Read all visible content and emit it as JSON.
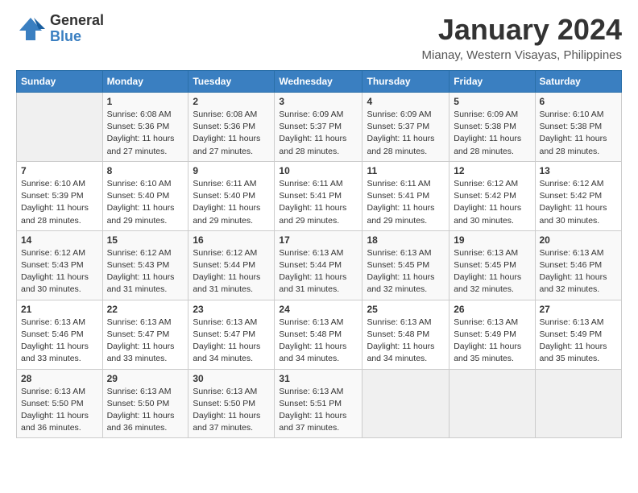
{
  "header": {
    "logo_general": "General",
    "logo_blue": "Blue",
    "month_title": "January 2024",
    "location": "Mianay, Western Visayas, Philippines"
  },
  "days_of_week": [
    "Sunday",
    "Monday",
    "Tuesday",
    "Wednesday",
    "Thursday",
    "Friday",
    "Saturday"
  ],
  "weeks": [
    [
      {
        "day": "",
        "sunrise": "",
        "sunset": "",
        "daylight": ""
      },
      {
        "day": "1",
        "sunrise": "Sunrise: 6:08 AM",
        "sunset": "Sunset: 5:36 PM",
        "daylight": "Daylight: 11 hours and 27 minutes."
      },
      {
        "day": "2",
        "sunrise": "Sunrise: 6:08 AM",
        "sunset": "Sunset: 5:36 PM",
        "daylight": "Daylight: 11 hours and 27 minutes."
      },
      {
        "day": "3",
        "sunrise": "Sunrise: 6:09 AM",
        "sunset": "Sunset: 5:37 PM",
        "daylight": "Daylight: 11 hours and 28 minutes."
      },
      {
        "day": "4",
        "sunrise": "Sunrise: 6:09 AM",
        "sunset": "Sunset: 5:37 PM",
        "daylight": "Daylight: 11 hours and 28 minutes."
      },
      {
        "day": "5",
        "sunrise": "Sunrise: 6:09 AM",
        "sunset": "Sunset: 5:38 PM",
        "daylight": "Daylight: 11 hours and 28 minutes."
      },
      {
        "day": "6",
        "sunrise": "Sunrise: 6:10 AM",
        "sunset": "Sunset: 5:38 PM",
        "daylight": "Daylight: 11 hours and 28 minutes."
      }
    ],
    [
      {
        "day": "7",
        "sunrise": "Sunrise: 6:10 AM",
        "sunset": "Sunset: 5:39 PM",
        "daylight": "Daylight: 11 hours and 28 minutes."
      },
      {
        "day": "8",
        "sunrise": "Sunrise: 6:10 AM",
        "sunset": "Sunset: 5:40 PM",
        "daylight": "Daylight: 11 hours and 29 minutes."
      },
      {
        "day": "9",
        "sunrise": "Sunrise: 6:11 AM",
        "sunset": "Sunset: 5:40 PM",
        "daylight": "Daylight: 11 hours and 29 minutes."
      },
      {
        "day": "10",
        "sunrise": "Sunrise: 6:11 AM",
        "sunset": "Sunset: 5:41 PM",
        "daylight": "Daylight: 11 hours and 29 minutes."
      },
      {
        "day": "11",
        "sunrise": "Sunrise: 6:11 AM",
        "sunset": "Sunset: 5:41 PM",
        "daylight": "Daylight: 11 hours and 29 minutes."
      },
      {
        "day": "12",
        "sunrise": "Sunrise: 6:12 AM",
        "sunset": "Sunset: 5:42 PM",
        "daylight": "Daylight: 11 hours and 30 minutes."
      },
      {
        "day": "13",
        "sunrise": "Sunrise: 6:12 AM",
        "sunset": "Sunset: 5:42 PM",
        "daylight": "Daylight: 11 hours and 30 minutes."
      }
    ],
    [
      {
        "day": "14",
        "sunrise": "Sunrise: 6:12 AM",
        "sunset": "Sunset: 5:43 PM",
        "daylight": "Daylight: 11 hours and 30 minutes."
      },
      {
        "day": "15",
        "sunrise": "Sunrise: 6:12 AM",
        "sunset": "Sunset: 5:43 PM",
        "daylight": "Daylight: 11 hours and 31 minutes."
      },
      {
        "day": "16",
        "sunrise": "Sunrise: 6:12 AM",
        "sunset": "Sunset: 5:44 PM",
        "daylight": "Daylight: 11 hours and 31 minutes."
      },
      {
        "day": "17",
        "sunrise": "Sunrise: 6:13 AM",
        "sunset": "Sunset: 5:44 PM",
        "daylight": "Daylight: 11 hours and 31 minutes."
      },
      {
        "day": "18",
        "sunrise": "Sunrise: 6:13 AM",
        "sunset": "Sunset: 5:45 PM",
        "daylight": "Daylight: 11 hours and 32 minutes."
      },
      {
        "day": "19",
        "sunrise": "Sunrise: 6:13 AM",
        "sunset": "Sunset: 5:45 PM",
        "daylight": "Daylight: 11 hours and 32 minutes."
      },
      {
        "day": "20",
        "sunrise": "Sunrise: 6:13 AM",
        "sunset": "Sunset: 5:46 PM",
        "daylight": "Daylight: 11 hours and 32 minutes."
      }
    ],
    [
      {
        "day": "21",
        "sunrise": "Sunrise: 6:13 AM",
        "sunset": "Sunset: 5:46 PM",
        "daylight": "Daylight: 11 hours and 33 minutes."
      },
      {
        "day": "22",
        "sunrise": "Sunrise: 6:13 AM",
        "sunset": "Sunset: 5:47 PM",
        "daylight": "Daylight: 11 hours and 33 minutes."
      },
      {
        "day": "23",
        "sunrise": "Sunrise: 6:13 AM",
        "sunset": "Sunset: 5:47 PM",
        "daylight": "Daylight: 11 hours and 34 minutes."
      },
      {
        "day": "24",
        "sunrise": "Sunrise: 6:13 AM",
        "sunset": "Sunset: 5:48 PM",
        "daylight": "Daylight: 11 hours and 34 minutes."
      },
      {
        "day": "25",
        "sunrise": "Sunrise: 6:13 AM",
        "sunset": "Sunset: 5:48 PM",
        "daylight": "Daylight: 11 hours and 34 minutes."
      },
      {
        "day": "26",
        "sunrise": "Sunrise: 6:13 AM",
        "sunset": "Sunset: 5:49 PM",
        "daylight": "Daylight: 11 hours and 35 minutes."
      },
      {
        "day": "27",
        "sunrise": "Sunrise: 6:13 AM",
        "sunset": "Sunset: 5:49 PM",
        "daylight": "Daylight: 11 hours and 35 minutes."
      }
    ],
    [
      {
        "day": "28",
        "sunrise": "Sunrise: 6:13 AM",
        "sunset": "Sunset: 5:50 PM",
        "daylight": "Daylight: 11 hours and 36 minutes."
      },
      {
        "day": "29",
        "sunrise": "Sunrise: 6:13 AM",
        "sunset": "Sunset: 5:50 PM",
        "daylight": "Daylight: 11 hours and 36 minutes."
      },
      {
        "day": "30",
        "sunrise": "Sunrise: 6:13 AM",
        "sunset": "Sunset: 5:50 PM",
        "daylight": "Daylight: 11 hours and 37 minutes."
      },
      {
        "day": "31",
        "sunrise": "Sunrise: 6:13 AM",
        "sunset": "Sunset: 5:51 PM",
        "daylight": "Daylight: 11 hours and 37 minutes."
      },
      {
        "day": "",
        "sunrise": "",
        "sunset": "",
        "daylight": ""
      },
      {
        "day": "",
        "sunrise": "",
        "sunset": "",
        "daylight": ""
      },
      {
        "day": "",
        "sunrise": "",
        "sunset": "",
        "daylight": ""
      }
    ]
  ]
}
